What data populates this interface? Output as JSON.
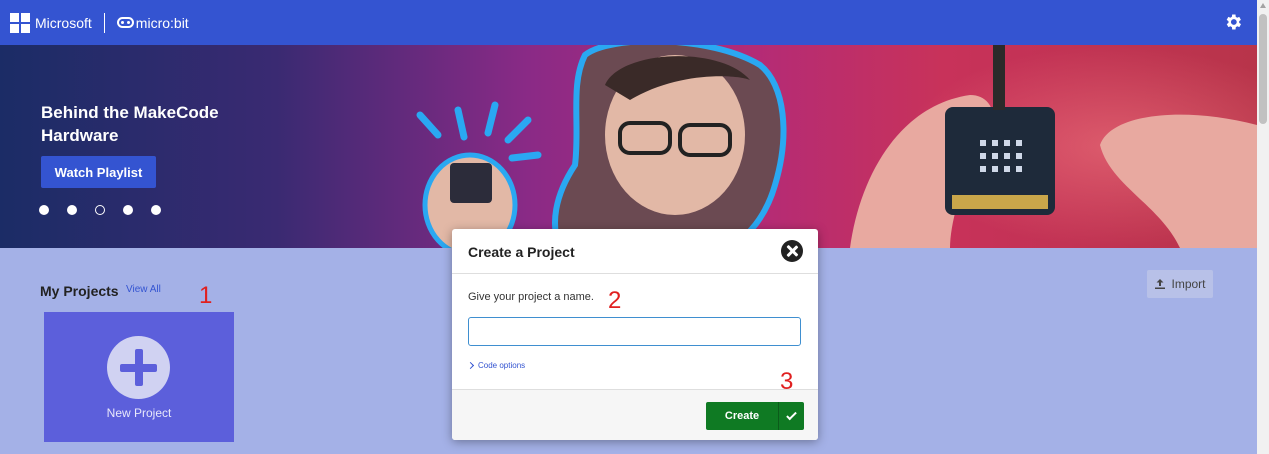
{
  "topbar": {
    "brand_label": "Microsoft",
    "product_label": "micro:bit",
    "settings_icon": "gear-icon",
    "background_color": "#3454d1"
  },
  "hero": {
    "title": "Behind the MakeCode Hardware",
    "watch_button": "Watch Playlist",
    "carousel": {
      "total_slides": 5,
      "active_slide": 3
    }
  },
  "projects": {
    "heading": "My Projects",
    "view_all": "View All",
    "import_label": "Import",
    "new_project_label": "New Project"
  },
  "dialog": {
    "title": "Create a Project",
    "prompt": "Give your project a name.",
    "name_value": "",
    "code_options": "Code options",
    "create_label": "Create"
  },
  "annotations": {
    "step1": "1",
    "step2": "2",
    "step3": "3"
  },
  "colors": {
    "accent": "#3454d1",
    "create_green": "#0f7a23",
    "page_bg": "#a4b1e7",
    "new_project_tile": "#5c5fdb",
    "annotation_red": "#e02020"
  }
}
